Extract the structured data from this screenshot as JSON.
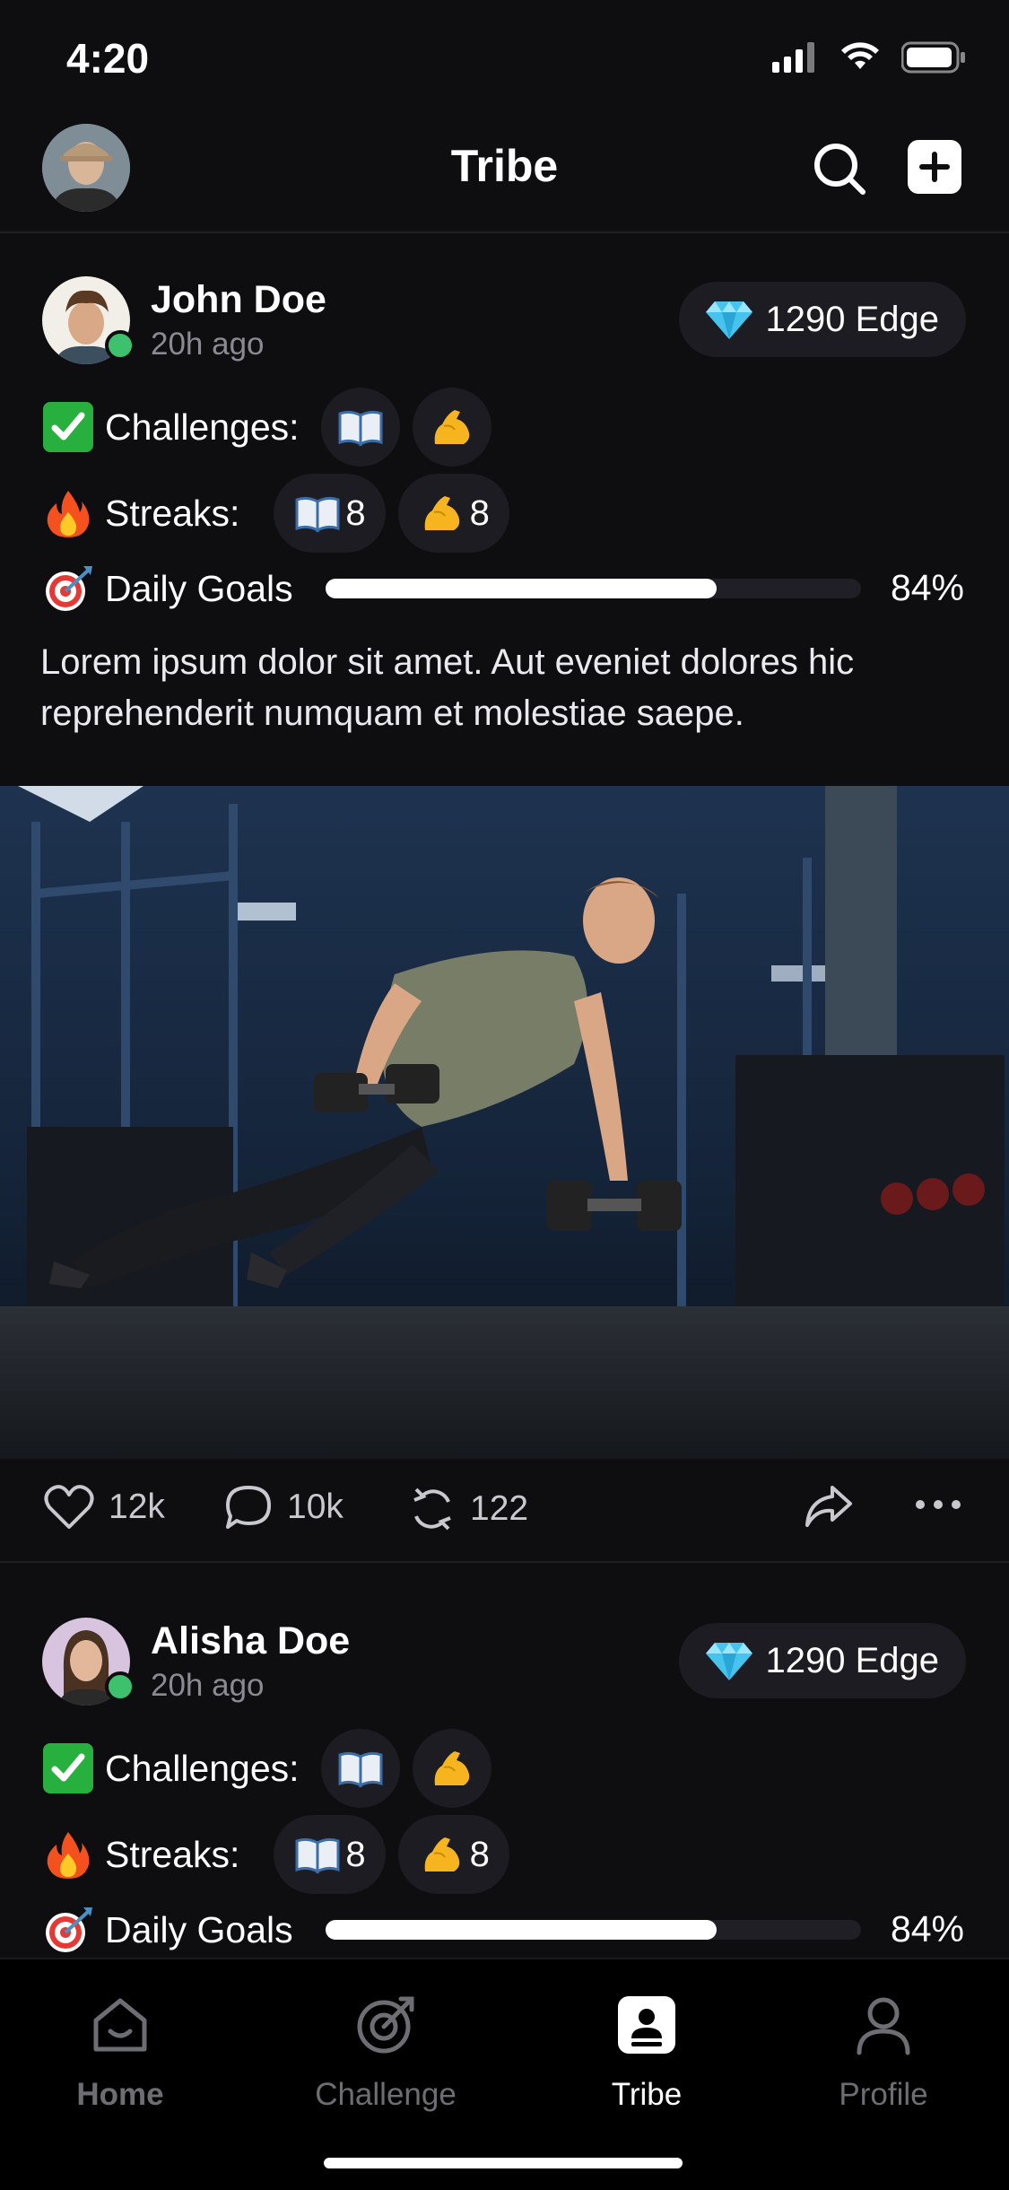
{
  "status_bar": {
    "time": "4:20"
  },
  "header": {
    "title": "Tribe"
  },
  "posts": [
    {
      "name": "John Doe",
      "time": "20h ago",
      "edge": "1290 Edge",
      "challenges_label": "Challenges:",
      "streaks_label": "Streaks:",
      "streaks": [
        {
          "icon": "book-icon",
          "count": "8"
        },
        {
          "icon": "flexed-bicep-icon",
          "count": "8"
        }
      ],
      "goals_label": "Daily Goals",
      "goals_percent": 84,
      "goals_value": "84%",
      "text": "Lorem ipsum dolor sit amet. Aut eveniet dolores hic reprehenderit numquam et molestiae saepe.",
      "likes": "12k",
      "comments": "10k",
      "reposts": "122"
    },
    {
      "name": "Alisha Doe",
      "time": "20h ago",
      "edge": "1290 Edge",
      "challenges_label": "Challenges:",
      "streaks_label": "Streaks:",
      "streaks": [
        {
          "icon": "book-icon",
          "count": "8"
        },
        {
          "icon": "flexed-bicep-icon",
          "count": "8"
        }
      ],
      "goals_label": "Daily Goals",
      "goals_percent": 84,
      "goals_value": "84%"
    }
  ],
  "tabs": [
    {
      "label": "Home",
      "icon": "home-icon"
    },
    {
      "label": "Challenge",
      "icon": "target-icon"
    },
    {
      "label": "Tribe",
      "icon": "tribe-icon",
      "active": true
    },
    {
      "label": "Profile",
      "icon": "user-icon"
    }
  ],
  "colors": {
    "background": "#0e0e11",
    "online": "#3ec16d",
    "chip": "#1c1c22"
  }
}
